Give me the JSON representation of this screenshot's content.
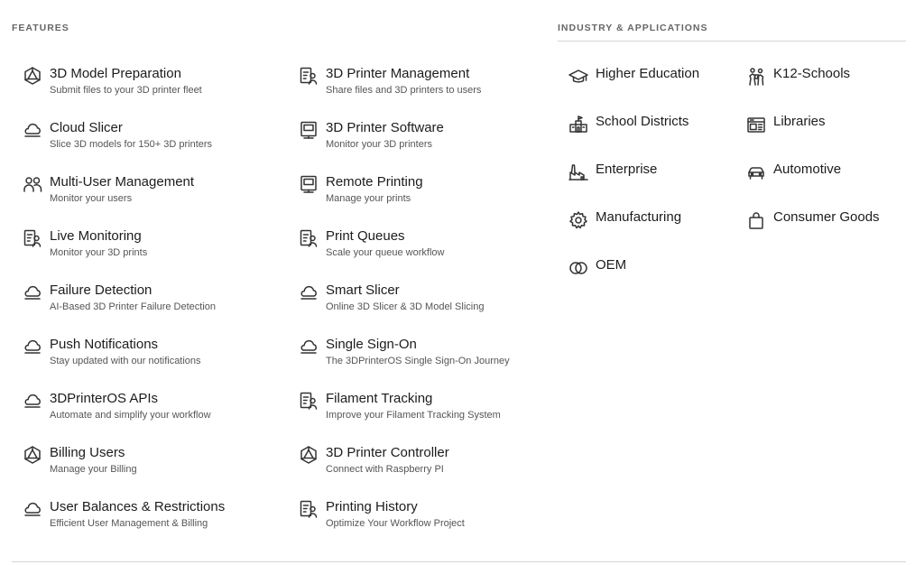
{
  "features": {
    "label": "FEATURES",
    "col1": [
      {
        "title": "3D Model Preparation",
        "desc": "Submit files to your 3D printer fleet",
        "icon": "polyhedron-icon"
      },
      {
        "title": "Cloud Slicer",
        "desc": "Slice 3D models for 150+ 3D printers",
        "icon": "cloud-icon"
      },
      {
        "title": "Multi-User Management",
        "desc": "Monitor your users",
        "icon": "users-icon"
      },
      {
        "title": "Live Monitoring",
        "desc": "Monitor your 3D prints",
        "icon": "user-list-icon"
      },
      {
        "title": "Failure Detection",
        "desc": "AI-Based 3D Printer Failure Detection",
        "icon": "cloud-icon"
      },
      {
        "title": "Push Notifications",
        "desc": "Stay updated with our notifications",
        "icon": "cloud-icon"
      },
      {
        "title": "3DPrinterOS APIs",
        "desc": "Automate and simplify your workflow",
        "icon": "cloud-icon"
      },
      {
        "title": "Billing Users",
        "desc": "Manage your Billing",
        "icon": "polyhedron-icon"
      },
      {
        "title": "User Balances & Restrictions",
        "desc": "Efficient User Management & Billing",
        "icon": "cloud-icon"
      }
    ],
    "col2": [
      {
        "title": "3D Printer Management",
        "desc": "Share files and 3D printers to users",
        "icon": "user-list-icon"
      },
      {
        "title": "3D Printer Software",
        "desc": "Monitor your 3D printers",
        "icon": "printer-frame-icon"
      },
      {
        "title": "Remote Printing",
        "desc": "Manage your prints",
        "icon": "printer-frame-icon"
      },
      {
        "title": "Print Queues",
        "desc": "Scale your queue workflow",
        "icon": "user-list-icon"
      },
      {
        "title": "Smart Slicer",
        "desc": "Online 3D Slicer & 3D Model Slicing",
        "icon": "cloud-icon"
      },
      {
        "title": "Single Sign-On",
        "desc": "The 3DPrinterOS Single Sign-On Journey",
        "icon": "cloud-icon"
      },
      {
        "title": "Filament Tracking",
        "desc": "Improve your Filament Tracking System",
        "icon": "user-list-icon"
      },
      {
        "title": "3D Printer Controller",
        "desc": "Connect with Raspberry PI",
        "icon": "polyhedron-icon"
      },
      {
        "title": "Printing History",
        "desc": "Optimize Your Workflow Project",
        "icon": "user-list-icon"
      }
    ]
  },
  "industry": {
    "label": "INDUSTRY & APPLICATIONS",
    "col1": [
      {
        "title": "Higher Education",
        "icon": "graduation-cap-icon"
      },
      {
        "title": "School Districts",
        "icon": "school-building-icon"
      },
      {
        "title": "Enterprise",
        "icon": "factory-icon"
      },
      {
        "title": "Manufacturing",
        "icon": "gear-icon"
      },
      {
        "title": "OEM",
        "icon": "overlapping-rings-icon"
      }
    ],
    "col2": [
      {
        "title": "K12-Schools",
        "icon": "students-icon"
      },
      {
        "title": "Libraries",
        "icon": "library-icon"
      },
      {
        "title": "Automotive",
        "icon": "car-icon"
      },
      {
        "title": "Consumer Goods",
        "icon": "shopping-bag-icon"
      }
    ]
  }
}
